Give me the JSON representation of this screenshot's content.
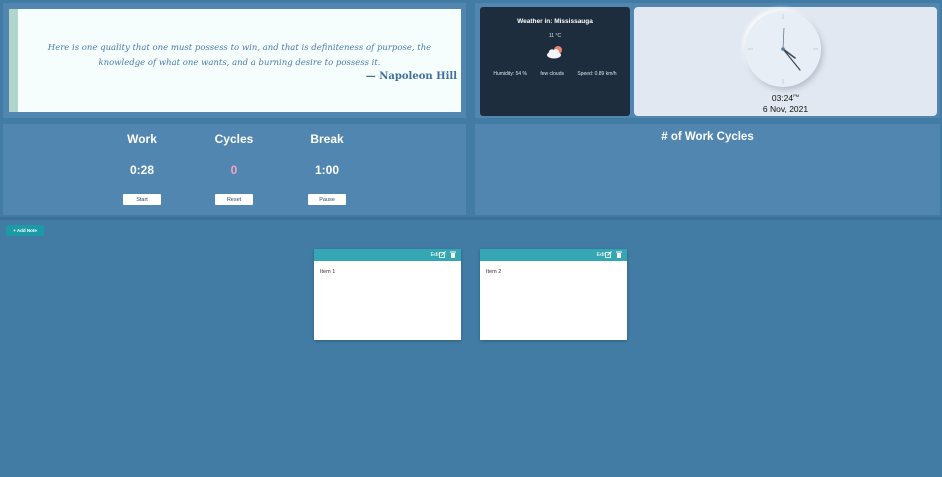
{
  "quote": {
    "text": "Here is one quality that one must possess to win, and that is definiteness of purpose, the knowledge of what one wants, and a burning desire to possess it.",
    "author": "— Napoleon Hill"
  },
  "weather": {
    "title": "Weather in: Mississauga",
    "temp": "11 °C",
    "icon": "partly-cloudy-icon",
    "humidity": "Humidity: 54 %",
    "conditions": "few clouds",
    "speed": "Speed: 0.89 km/h"
  },
  "clock": {
    "time": "03:24",
    "ampm": "PM",
    "date": "6 Nov, 2021"
  },
  "pomodoro": {
    "work_label": "Work",
    "work_value": "0:28",
    "start_label": "Start",
    "cycles_label": "Cycles",
    "cycles_value": "0",
    "reset_label": "Reset",
    "break_label": "Break",
    "break_value": "1:00",
    "pause_label": "Pause"
  },
  "cycles_panel": {
    "title": "# of Work Cycles"
  },
  "notes": {
    "add_label": "+ Add Note",
    "edit_label": "Edit",
    "items": [
      {
        "text": "Item 1"
      },
      {
        "text": "Item 2"
      }
    ]
  },
  "colors": {
    "background": "#427ca5",
    "panel": "#5086b0",
    "accent": "#35a6b3",
    "cycles_value": "#f3a5bc"
  }
}
